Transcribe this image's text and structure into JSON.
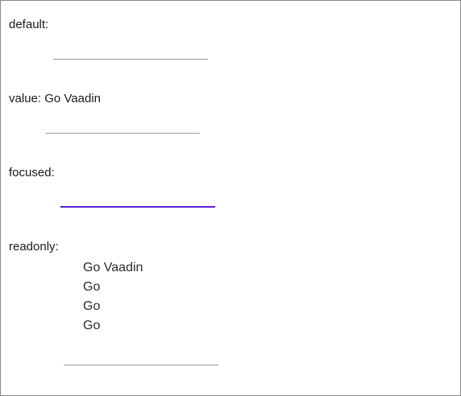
{
  "sections": {
    "default": {
      "label": "default:"
    },
    "value": {
      "label": "value: Go Vaadin"
    },
    "focused": {
      "label": "focused:"
    },
    "readonly": {
      "label": "readonly:",
      "lines": [
        "Go Vaadin",
        "Go",
        "Go",
        "Go"
      ]
    }
  },
  "colors": {
    "focus_underline": "#5a1ecf",
    "underline": "#9a9a9a",
    "border": "#8a8a8a"
  }
}
